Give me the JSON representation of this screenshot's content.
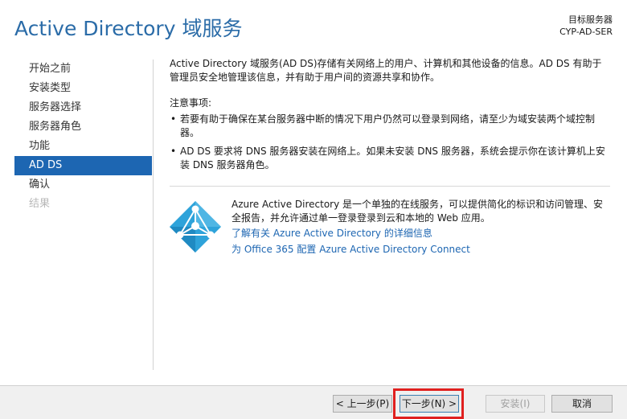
{
  "header": {
    "title": "Active Directory 域服务",
    "target_label": "目标服务器",
    "target_server": "CYP-AD-SER"
  },
  "sidebar": {
    "items": [
      {
        "label": "开始之前",
        "state": "normal"
      },
      {
        "label": "安装类型",
        "state": "normal"
      },
      {
        "label": "服务器选择",
        "state": "normal"
      },
      {
        "label": "服务器角色",
        "state": "normal"
      },
      {
        "label": "功能",
        "state": "normal"
      },
      {
        "label": "AD DS",
        "state": "active"
      },
      {
        "label": "确认",
        "state": "normal"
      },
      {
        "label": "结果",
        "state": "disabled"
      }
    ]
  },
  "main": {
    "intro": "Active Directory 域服务(AD DS)存储有关网络上的用户、计算机和其他设备的信息。AD DS 有助于管理员安全地管理该信息，并有助于用户间的资源共享和协作。",
    "notes_title": "注意事项:",
    "notes": [
      "若要有助于确保在某台服务器中断的情况下用户仍然可以登录到网络，请至少为域安装两个域控制器。",
      "AD DS 要求将 DNS 服务器安装在网络上。如果未安装 DNS 服务器，系统会提示你在该计算机上安装 DNS 服务器角色。"
    ],
    "azure": {
      "icon": "azure-ad-icon",
      "description": "Azure Active Directory 是一个单独的在线服务，可以提供简化的标识和访问管理、安全报告，并允许通过单一登录登录到云和本地的 Web 应用。",
      "link1": "了解有关 Azure Active Directory 的详细信息",
      "link2": "为 Office 365 配置 Azure Active Directory Connect"
    }
  },
  "footer": {
    "prev": "< 上一步(P)",
    "next": "下一步(N) >",
    "install": "安装(I)",
    "cancel": "取消"
  },
  "colors": {
    "accent": "#1d66b2",
    "title": "#2b6ca8",
    "azure": "#2ea3da",
    "highlight": "#e0201f"
  }
}
